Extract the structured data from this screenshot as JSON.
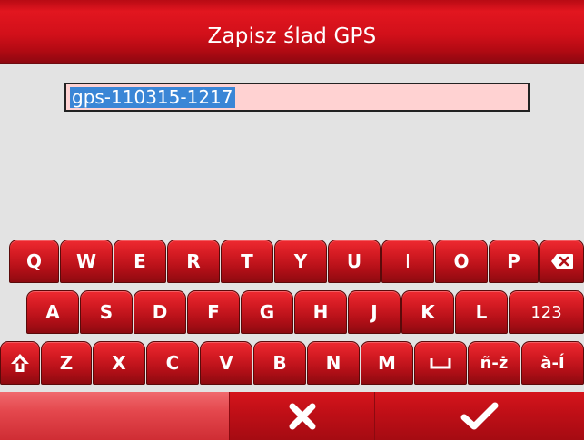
{
  "title": "Zapisz ślad GPS",
  "input": {
    "value": "gps-110315-1217"
  },
  "keyboard": {
    "row1": [
      "Q",
      "W",
      "E",
      "R",
      "T",
      "Y",
      "U",
      "I",
      "O",
      "P"
    ],
    "row2": [
      "A",
      "S",
      "D",
      "F",
      "G",
      "H",
      "J",
      "K",
      "L",
      "123"
    ],
    "row3": [
      "Z",
      "X",
      "C",
      "V",
      "B",
      "N",
      "M",
      "ñ-ż",
      "à-Í"
    ],
    "icons": {
      "backspace": "backspace-icon",
      "shift": "shift-icon",
      "space": "space-icon"
    }
  },
  "bottom_bar": {
    "cancel_icon": "close-icon",
    "confirm_icon": "checkmark-icon"
  },
  "colors": {
    "accent": "#d2101a",
    "field_bg": "#ffd2d2",
    "selection": "#3a86d6"
  }
}
